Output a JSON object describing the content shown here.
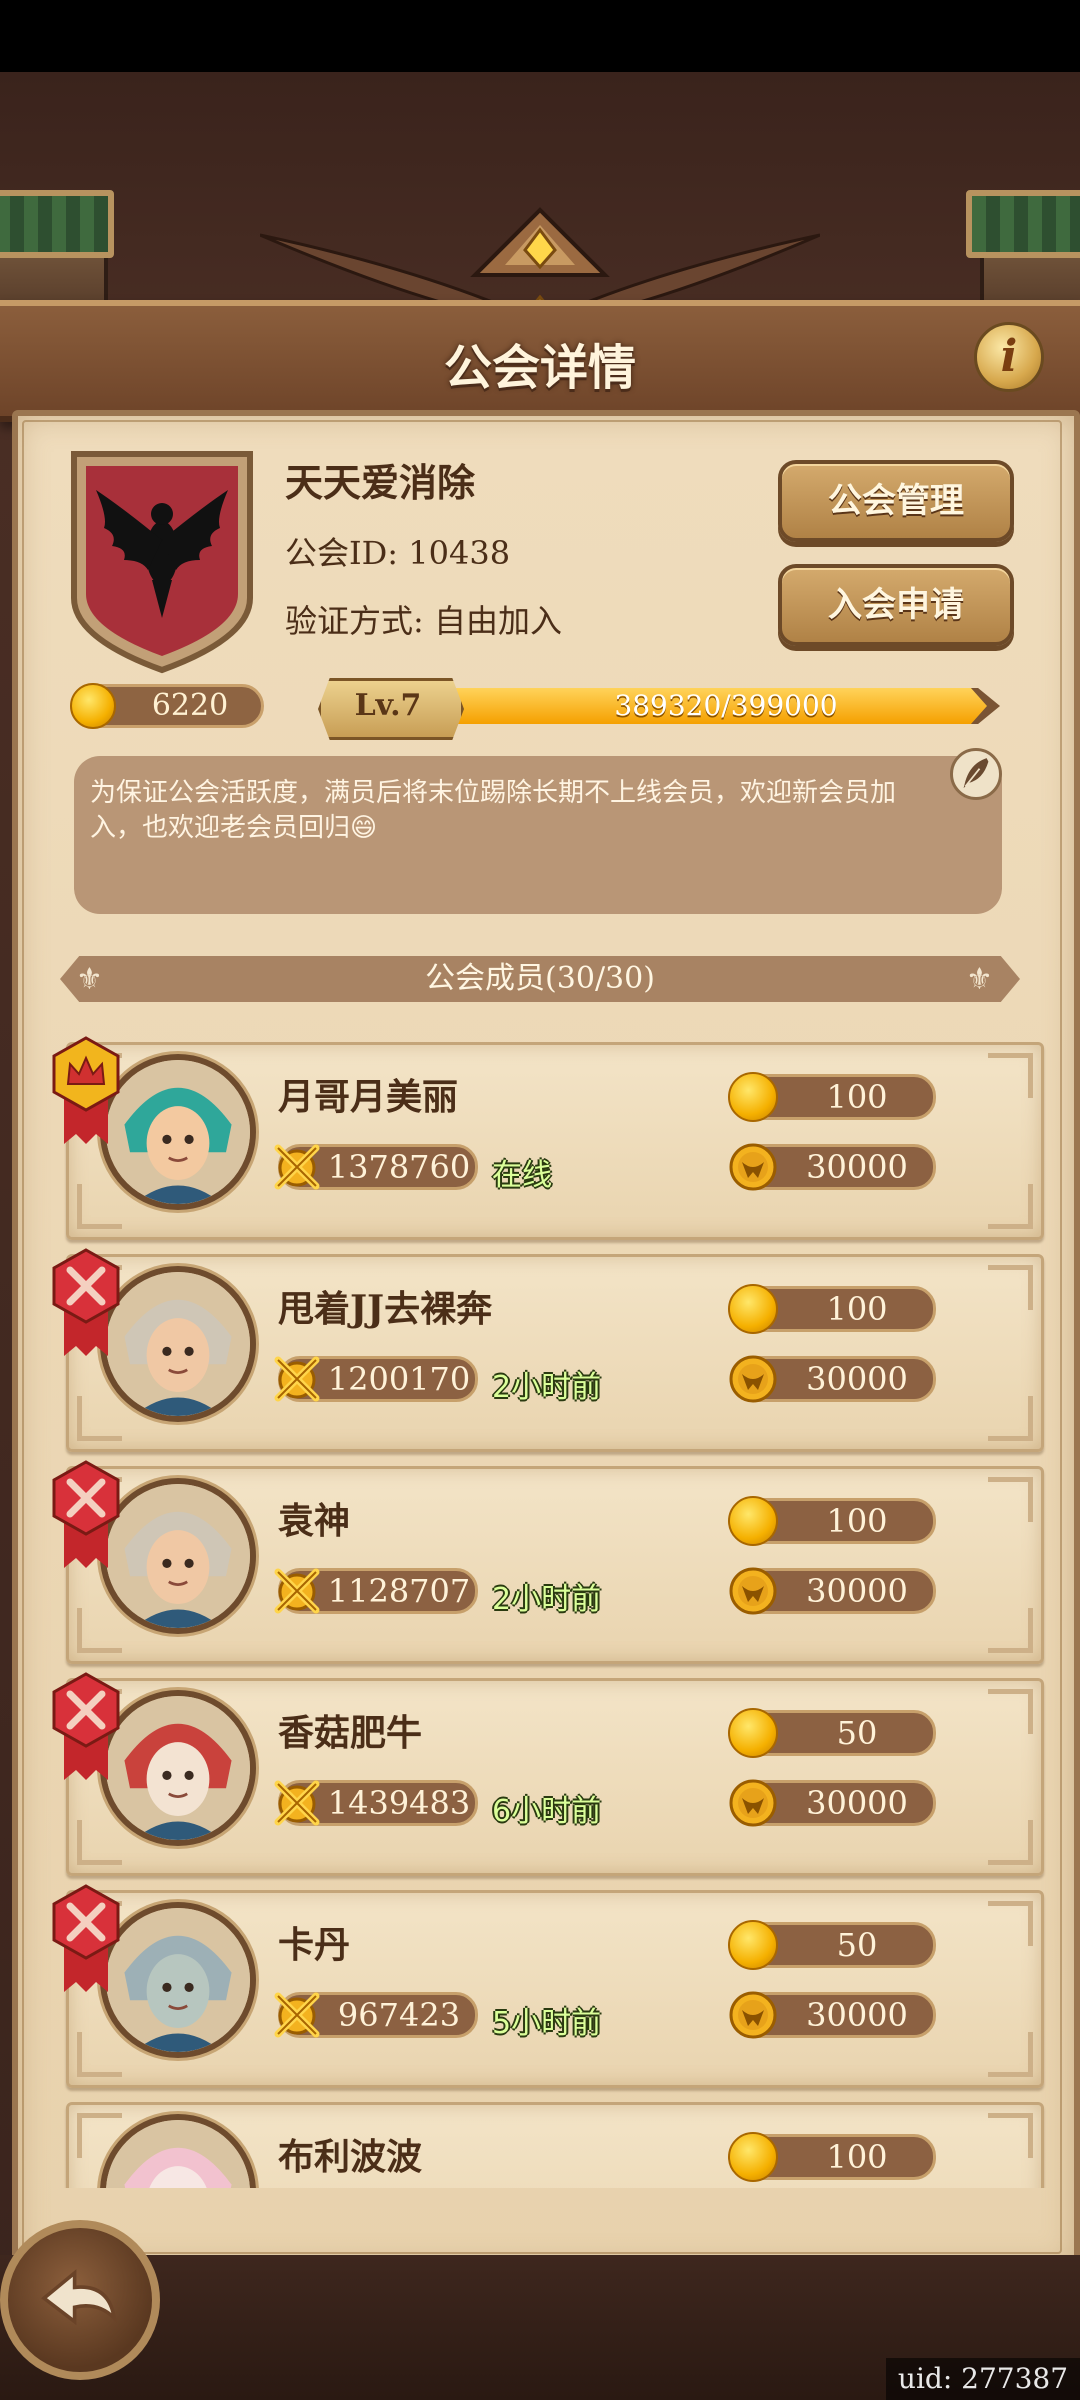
{
  "header": {
    "title": "公会详情",
    "info_button": "i"
  },
  "guild": {
    "name": "天天爱消除",
    "id_label": "公会ID: 10438",
    "verify_label": "验证方式: 自由加入",
    "coins": "6220",
    "level": "Lv.7",
    "xp_text": "389320/399000",
    "xp_progress": 0.976,
    "manage_button": "公会管理",
    "apply_button": "入会申请",
    "announcement": "为保证公会活跃度，满员后将末位踢除长期不上线会员，欢迎新会员加入，也欢迎老会员回归😄"
  },
  "members_header": "公会成员(30/30)",
  "members": [
    {
      "name": "月哥月美丽",
      "power": "1378760",
      "status": "在线",
      "contribution": "100",
      "score": "30000",
      "rank": "leader-crown-ribbon",
      "avatar": "green-hair-elf-avatar"
    },
    {
      "name": "甩着JJ去裸奔",
      "power": "1200170",
      "status": "2小时前",
      "contribution": "100",
      "score": "30000",
      "rank": "crossed-swords-ribbon",
      "avatar": "goggles-girl-avatar"
    },
    {
      "name": "袁神",
      "power": "1128707",
      "status": "2小时前",
      "contribution": "100",
      "score": "30000",
      "rank": "crossed-swords-ribbon",
      "avatar": "goggles-girl-avatar"
    },
    {
      "name": "香菇肥牛",
      "power": "1439483",
      "status": "6小时前",
      "contribution": "50",
      "score": "30000",
      "rank": "crossed-swords-ribbon",
      "avatar": "red-dragon-avatar"
    },
    {
      "name": "卡丹",
      "power": "967423",
      "status": "5小时前",
      "contribution": "50",
      "score": "30000",
      "rank": "crossed-swords-ribbon",
      "avatar": "goblin-elder-avatar"
    },
    {
      "name": "布利波波",
      "power": "",
      "status": "",
      "contribution": "100",
      "score": "",
      "rank": "",
      "avatar": "pink-fairy-avatar"
    }
  ],
  "footer": {
    "uid": "uid: 277387"
  },
  "colors": {
    "parchment": "#efdcbc",
    "wood": "#6e4429",
    "gold": "#f5b000",
    "online_green": "#dbff9a"
  }
}
